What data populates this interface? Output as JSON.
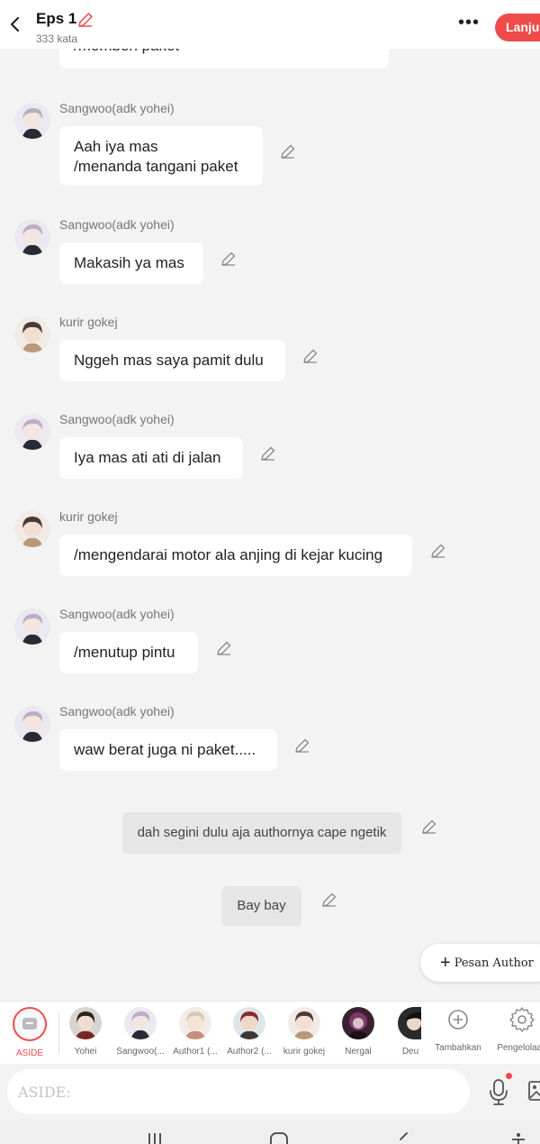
{
  "header": {
    "title": "Eps 1",
    "word_count": "333 kata",
    "continue_label": "Lanjut",
    "more_label": "•••"
  },
  "messages": [
    {
      "type": "bubble",
      "text": "/memberi paket"
    },
    {
      "type": "chat",
      "author": "Sangwoo(adk yohei)",
      "text": "Aah iya mas\n/menanda tangani paket"
    },
    {
      "type": "chat",
      "author": "Sangwoo(adk yohei)",
      "text": "Makasih ya mas"
    },
    {
      "type": "chat",
      "author": "kurir gokej",
      "text": "Nggeh mas saya pamit dulu"
    },
    {
      "type": "chat",
      "author": "Sangwoo(adk yohei)",
      "text": "Iya mas ati ati di jalan"
    },
    {
      "type": "chat",
      "author": "kurir gokej",
      "text": "/mengendarai motor ala anjing di kejar kucing"
    },
    {
      "type": "chat",
      "author": "Sangwoo(adk yohei)",
      "text": "/menutup pintu"
    },
    {
      "type": "chat",
      "author": "Sangwoo(adk yohei)",
      "text": "waw berat juga ni paket....."
    },
    {
      "type": "narration",
      "text": "dah segini dulu aja authornya cape ngetik"
    },
    {
      "type": "narration",
      "text": "Bay bay"
    }
  ],
  "fab": {
    "label": "Pesan Author",
    "icon": "plus-icon"
  },
  "characters": [
    {
      "label": "ASIDE",
      "icon": "message-icon",
      "selected": true
    },
    {
      "label": "Yohei"
    },
    {
      "label": "Sangwoo(..."
    },
    {
      "label": "Author1 (..."
    },
    {
      "label": "Author2 (..."
    },
    {
      "label": "kurir gokej"
    },
    {
      "label": "Nergal"
    },
    {
      "label": "Deu"
    },
    {
      "label": "Tambahkan",
      "icon": "add-circle-icon"
    },
    {
      "label": "Pengelolaan",
      "icon": "gear-icon"
    }
  ],
  "composer": {
    "placeholder": "ASIDE:",
    "mic_icon": "microphone-icon",
    "image_icon": "image-icon"
  },
  "colors": {
    "accent": "#ef4b4b",
    "bubble": "#ffffff",
    "background": "#f3f3f3",
    "narration": "#e6e6e6"
  }
}
